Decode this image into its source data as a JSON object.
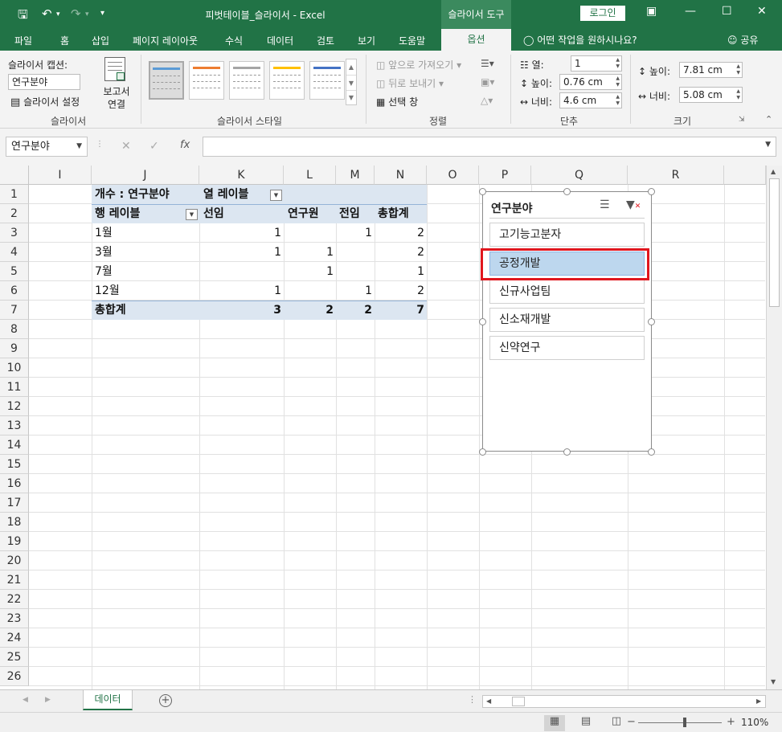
{
  "titlebar": {
    "title": "피벗테이블_슬라이서  -  Excel",
    "context_tab": "슬라이서 도구",
    "login": "로그인",
    "save_icon": "save-icon",
    "undo_icon": "undo-icon",
    "redo_icon": "redo-icon"
  },
  "tabs": [
    {
      "label": "파일"
    },
    {
      "label": "홈"
    },
    {
      "label": "삽입"
    },
    {
      "label": "페이지 레이아웃"
    },
    {
      "label": "수식"
    },
    {
      "label": "데이터"
    },
    {
      "label": "검토"
    },
    {
      "label": "보기"
    },
    {
      "label": "도움말"
    },
    {
      "label": "옵션"
    }
  ],
  "tell_me": "어떤 작업을 원하시나요?",
  "share": "공유",
  "ribbon": {
    "slicer_caption_label": "슬라이서 캡션:",
    "slicer_caption_value": "연구분야",
    "slicer_settings": "슬라이서 설정",
    "report_conn_line1": "보고서",
    "report_conn_line2": "연결",
    "group_slicer": "슬라이서",
    "group_styles": "슬라이서 스타일",
    "bring_forward": "앞으로 가져오기",
    "send_backward": "뒤로 보내기",
    "selection_pane": "선택 창",
    "group_arrange": "정렬",
    "columns_label": "열:",
    "columns_value": "1",
    "btn_height_label": "높이:",
    "btn_height_value": "0.76 cm",
    "btn_width_label": "너비:",
    "btn_width_value": "4.6 cm",
    "group_buttons": "단추",
    "size_height_label": "높이:",
    "size_height_value": "7.81 cm",
    "size_width_label": "너비:",
    "size_width_value": "5.08 cm",
    "group_size": "크기"
  },
  "formula_bar": {
    "name_box": "연구분야",
    "fx": "fx",
    "value": ""
  },
  "columns": [
    "I",
    "J",
    "K",
    "L",
    "M",
    "N",
    "O",
    "P",
    "Q",
    "R"
  ],
  "rows": [
    "1",
    "2",
    "3",
    "4",
    "5",
    "6",
    "7",
    "8",
    "9",
    "10",
    "11",
    "12",
    "13",
    "14",
    "15",
    "16",
    "17",
    "18",
    "19",
    "20",
    "21",
    "22",
    "23",
    "24",
    "25",
    "26"
  ],
  "pivot": {
    "value_header": "개수 : 연구분야",
    "col_labels_header": "열 레이블",
    "row_labels_header": "행 레이블",
    "col_items": [
      "선임",
      "연구원",
      "전임",
      "총합계"
    ],
    "rows": [
      {
        "label": "1월",
        "values": [
          "1",
          "",
          "1",
          "2"
        ]
      },
      {
        "label": "3월",
        "values": [
          "1",
          "1",
          "",
          "2"
        ]
      },
      {
        "label": "7월",
        "values": [
          "",
          "1",
          "",
          "1"
        ]
      },
      {
        "label": "12월",
        "values": [
          "1",
          "",
          "1",
          "2"
        ]
      }
    ],
    "total": {
      "label": "총합계",
      "values": [
        "3",
        "2",
        "2",
        "7"
      ]
    }
  },
  "slicer": {
    "header": "연구분야",
    "items": [
      {
        "label": "고기능고분자",
        "selected": false
      },
      {
        "label": "공정개발",
        "selected": true
      },
      {
        "label": "신규사업팀",
        "selected": false
      },
      {
        "label": "신소재개발",
        "selected": false
      },
      {
        "label": "신약연구",
        "selected": false
      }
    ],
    "selected_color": "#bdd7ee"
  },
  "sheet_tab": "데이터",
  "status": {
    "zoom": "110%"
  },
  "colors": {
    "excel_green": "#217346",
    "pivot_fill": "#dce6f1",
    "highlight_red": "#e0161e"
  }
}
